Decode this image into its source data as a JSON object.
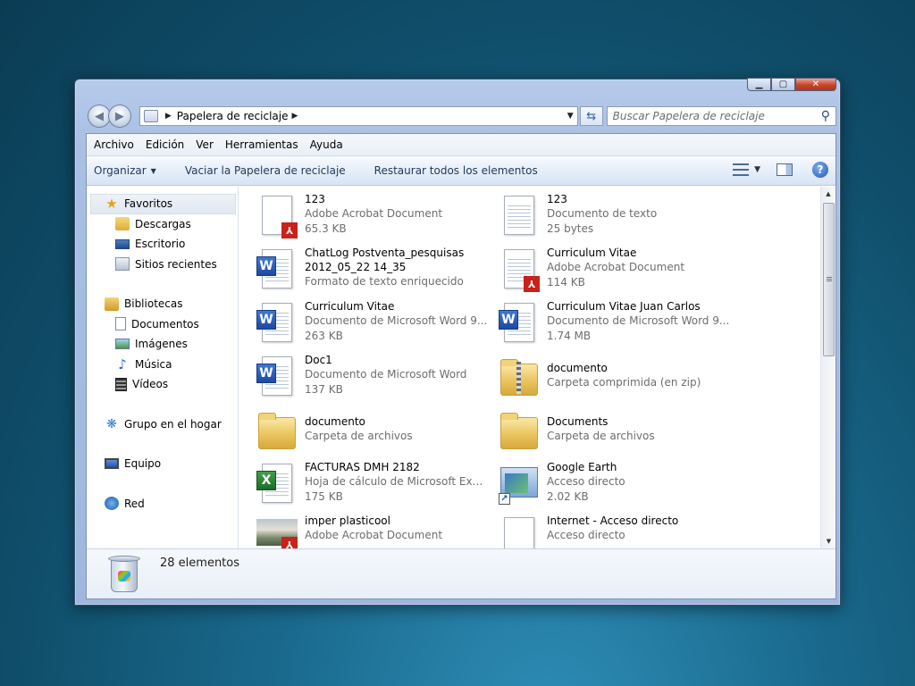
{
  "window": {
    "address": {
      "location": "Papelera de reciclaje"
    },
    "search": {
      "placeholder": "Buscar Papelera de reciclaje"
    }
  },
  "menubar": [
    "Archivo",
    "Edición",
    "Ver",
    "Herramientas",
    "Ayuda"
  ],
  "toolbar": {
    "organize": "Organizar",
    "empty": "Vaciar la Papelera de reciclaje",
    "restore": "Restaurar todos los elementos"
  },
  "nav": {
    "favorites": {
      "label": "Favoritos",
      "items": [
        "Descargas",
        "Escritorio",
        "Sitios recientes"
      ]
    },
    "libraries": {
      "label": "Bibliotecas",
      "items": [
        "Documentos",
        "Imágenes",
        "Música",
        "Vídeos"
      ]
    },
    "homegroup": "Grupo en el hogar",
    "computer": "Equipo",
    "network": "Red"
  },
  "files": [
    {
      "name": "123",
      "type": "Adobe Acrobat Document",
      "size": "65.3 KB",
      "icon": "pdf-icon"
    },
    {
      "name": "123",
      "type": "Documento de texto",
      "size": "25 bytes",
      "icon": "text-document-icon"
    },
    {
      "name": "ChatLog Postventa_pesquisas",
      "name2": "2012_05_22 14_35",
      "type": "Formato de texto enriquecido",
      "icon": "word-document-icon"
    },
    {
      "name": "Curriculum Vitae",
      "type": "Adobe Acrobat Document",
      "size": "114 KB",
      "icon": "pdf-icon"
    },
    {
      "name": "Curriculum Vitae",
      "type": "Documento de Microsoft Word 9...",
      "size": "263 KB",
      "icon": "word-document-icon"
    },
    {
      "name": "Curriculum Vitae Juan Carlos",
      "type": "Documento de Microsoft Word 9...",
      "size": "1.74 MB",
      "icon": "word-document-icon"
    },
    {
      "name": "Doc1",
      "type": "Documento de Microsoft Word",
      "size": "137 KB",
      "icon": "word-document-icon"
    },
    {
      "name": "documento",
      "type": "Carpeta comprimida (en zip)",
      "icon": "zip-folder-icon"
    },
    {
      "name": "documento",
      "type": "Carpeta de archivos",
      "icon": "folder-icon"
    },
    {
      "name": "Documents",
      "type": "Carpeta de archivos",
      "icon": "folder-icon"
    },
    {
      "name": "FACTURAS DMH  2182",
      "type": "Hoja de cálculo de Microsoft Exce...",
      "size": "175 KB",
      "icon": "excel-spreadsheet-icon"
    },
    {
      "name": "Google Earth",
      "type": "Acceso directo",
      "size": "2.02 KB",
      "icon": "shortcut-icon"
    },
    {
      "name": "imper plasticool",
      "type": "Adobe Acrobat Document",
      "icon": "pdf-icon"
    },
    {
      "name": "Internet - Acceso directo",
      "type": "Acceso directo",
      "icon": "shortcut-icon"
    }
  ],
  "details": {
    "count": "28 elementos"
  }
}
